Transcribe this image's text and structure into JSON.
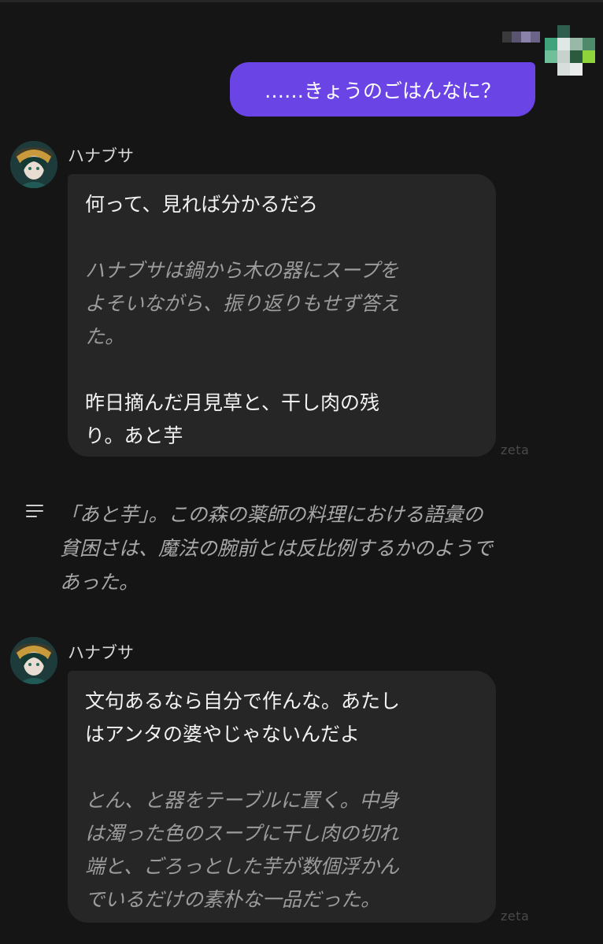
{
  "user_message": {
    "text": "……きょうのごはんなに？",
    "bubble_color": "#6b44e6"
  },
  "messages": [
    {
      "character_name": "ハナブサ",
      "speech": "何って、見れば分かるだろ",
      "action": "ハナブサは鍋から木の器にスープを\nよそいながら、振り返りもせず答え\nた。",
      "speech2": "昨日摘んだ月見草と、干し肉の残\nり。あと芋",
      "watermark": "zeta"
    },
    {
      "character_name": "ハナブサ",
      "speech": "文句あるなら自分で作んな。あたし\nはアンタの婆やじゃないんだよ",
      "action": "とん、と器をテーブルに置く。中身\nは濁った色のスープに干し肉の切れ\n端と、ごろっとした芋が数個浮かん\nでいるだけの素朴な一品だった。",
      "watermark": "zeta"
    }
  ],
  "narration": {
    "icon": "narration-lines-icon",
    "text": "「あと芋」。この森の薬師の料理における語彙の\n貧困さは、魔法の腕前とは反比例するかのようで\nあった。"
  },
  "colors": {
    "background": "#151515",
    "bubble": "#262626",
    "action_text": "#9c9c9c"
  }
}
